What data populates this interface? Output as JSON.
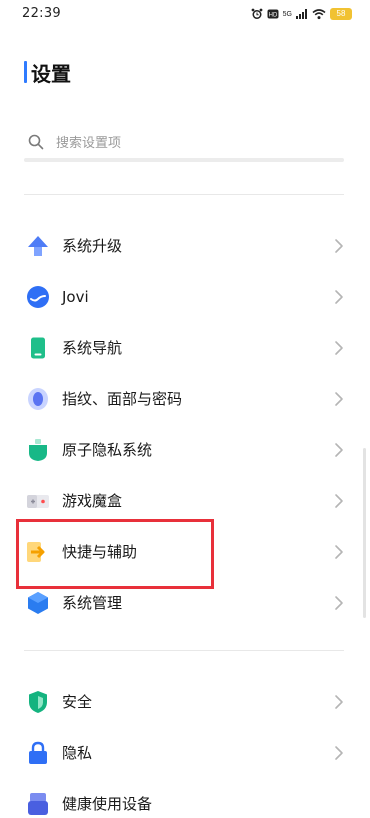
{
  "status_bar": {
    "time": "22:39",
    "network_label": "5G",
    "battery_text": "58",
    "battery_color": "#f1c232"
  },
  "header": {
    "title": "设置",
    "accent_color": "#2f7bff"
  },
  "search": {
    "placeholder": "搜索设置项",
    "icon": "search-icon"
  },
  "sections": [
    {
      "items": [
        {
          "key": "system-upgrade",
          "label": "系统升级",
          "icon": "arrow-up-icon"
        },
        {
          "key": "jovi",
          "label": "Jovi",
          "icon": "jovi-icon"
        },
        {
          "key": "system-navigation",
          "label": "系统导航",
          "icon": "phone-icon"
        },
        {
          "key": "fingerprint-face-password",
          "label": "指纹、面部与密码",
          "icon": "fingerprint-icon"
        },
        {
          "key": "privacy-system",
          "label": "原子隐私系统",
          "icon": "privacy-shield-icon"
        },
        {
          "key": "game-box",
          "label": "游戏魔盒",
          "icon": "gamepad-icon"
        },
        {
          "key": "shortcuts-accessibility",
          "label": "快捷与辅助",
          "icon": "shortcut-arrow-icon"
        },
        {
          "key": "system-management",
          "label": "系统管理",
          "icon": "hexagon-icon"
        }
      ]
    },
    {
      "items": [
        {
          "key": "security",
          "label": "安全",
          "icon": "shield-icon"
        },
        {
          "key": "privacy",
          "label": "隐私",
          "icon": "lock-icon"
        },
        {
          "key": "health-devices",
          "label": "健康使用设备",
          "icon": "health-icon"
        }
      ]
    }
  ],
  "highlight": {
    "target": "快捷与辅助",
    "color": "#e8303a"
  }
}
